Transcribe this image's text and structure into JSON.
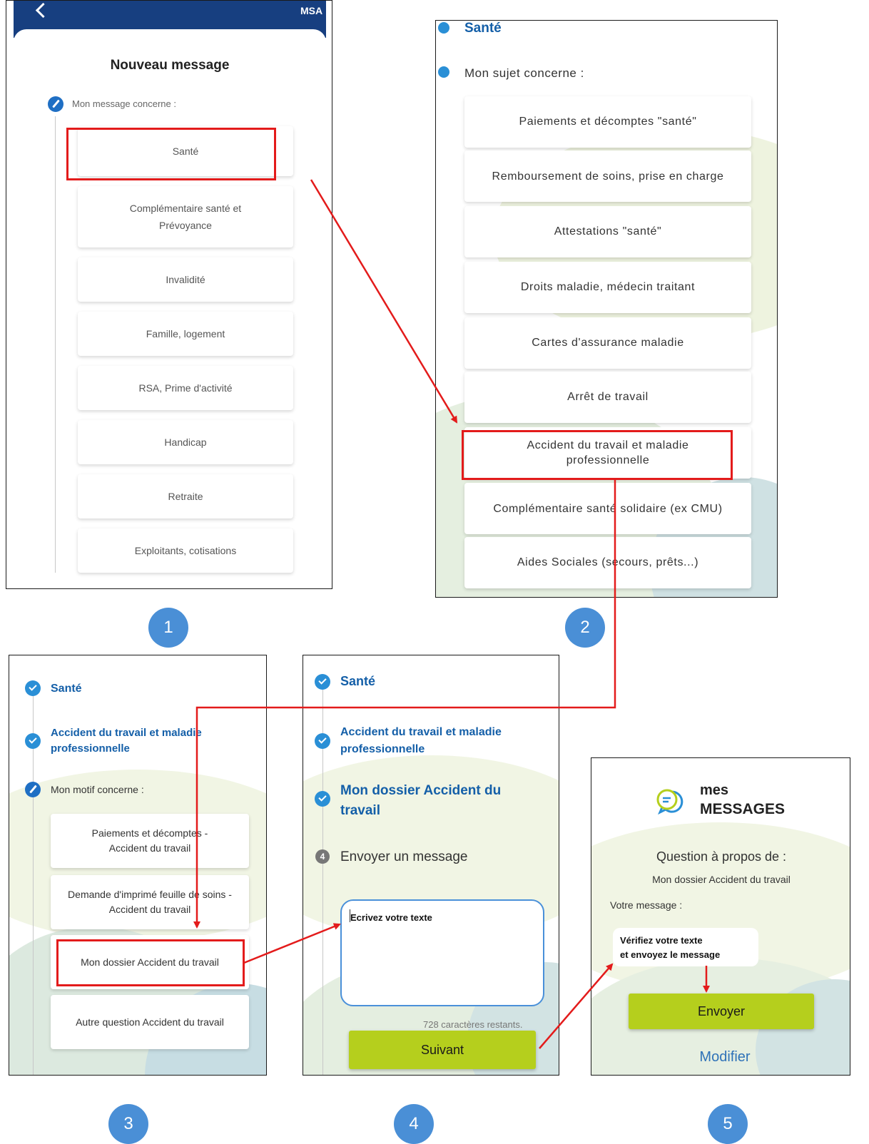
{
  "panel1": {
    "msa_logo": "MSA",
    "title": "Nouveau message",
    "subtitle": "Mon message concerne :",
    "options": [
      "Santé",
      "Complémentaire santé et Prévoyance",
      "Invalidité",
      "Famille, logement",
      "RSA, Prime d'activité",
      "Handicap",
      "Retraite",
      "Exploitants, cotisations"
    ]
  },
  "panel2": {
    "sante": "Santé",
    "subtitle": "Mon sujet concerne :",
    "options": [
      "Paiements et décomptes \"santé\"",
      "Remboursement de soins, prise en charge",
      "Attestations \"santé\"",
      "Droits maladie, médecin traitant",
      "Cartes d'assurance maladie",
      "Arrêt de travail",
      "Accident du travail et maladie professionnelle",
      "Complémentaire santé solidaire (ex CMU)",
      "Aides Sociales (secours, prêts...)"
    ]
  },
  "panel3": {
    "step1": "Santé",
    "step2": "Accident du travail et maladie professionnelle",
    "subtitle": "Mon motif concerne :",
    "options": [
      "Paiements et décomptes - Accident du travail",
      "Demande d'imprimé feuille de soins - Accident du travail",
      "Mon dossier Accident du travail",
      "Autre question Accident du travail"
    ]
  },
  "panel4": {
    "step1": "Santé",
    "step2": "Accident du travail et maladie professionnelle",
    "step3": "Mon dossier Accident du travail",
    "step4_num": "4",
    "step4": "Envoyer un message",
    "textarea_hint": "Ecrivez votre texte",
    "chars_left": "728 caractères restants.",
    "next_button": "Suivant"
  },
  "panel5": {
    "brand_line1": "mes",
    "brand_line2": "MESSAGES",
    "question_title": "Question à propos de :",
    "question_subject": "Mon dossier Accident du travail",
    "message_label": "Votre message :",
    "check_hint_line1": "Vérifiez votre texte",
    "check_hint_line2": "et envoyez le message",
    "send_button": "Envoyer",
    "modify_link": "Modifier"
  },
  "steps": [
    "1",
    "2",
    "3",
    "4",
    "5"
  ],
  "colors": {
    "highlight": "#e31b1b",
    "accent_blue": "#145fa8",
    "button_green": "#b5cf1d",
    "badge_blue": "#4a8fd6"
  }
}
